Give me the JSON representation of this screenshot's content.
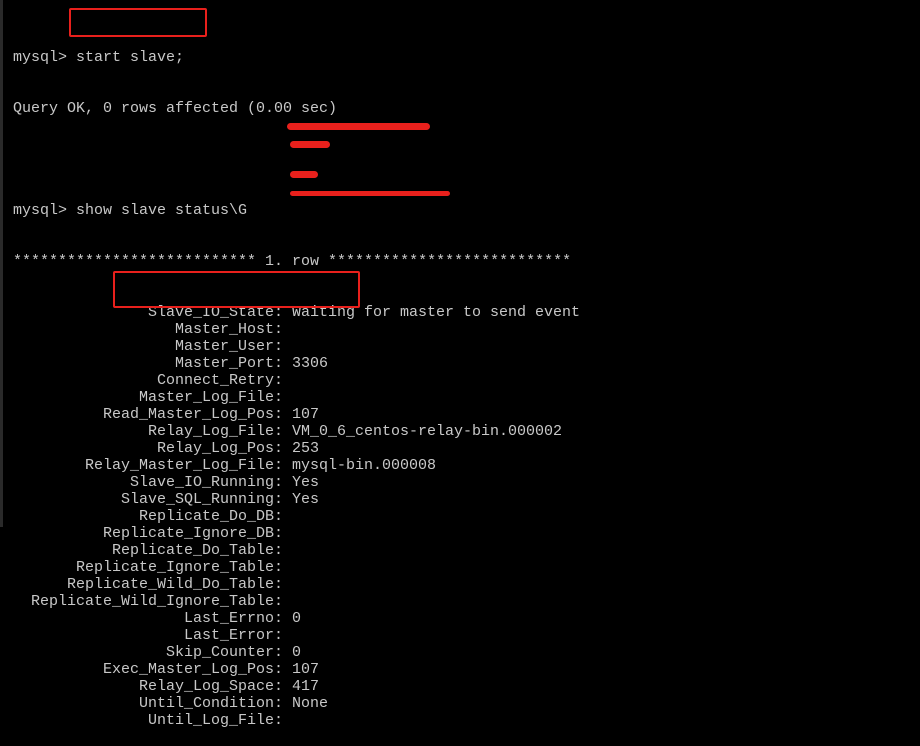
{
  "terminal": {
    "prompt": "mysql> ",
    "command1": "start slave;",
    "result1": "Query OK, 0 rows affected (0.00 sec)",
    "command2": "show slave status\\G",
    "row_header": "*************************** 1. row ***************************",
    "fields": [
      {
        "key": "Slave_IO_State",
        "value": "Waiting for master to send event"
      },
      {
        "key": "Master_Host",
        "value": "",
        "redacted": true
      },
      {
        "key": "Master_User",
        "value": "",
        "redacted": true
      },
      {
        "key": "Master_Port",
        "value": "3306"
      },
      {
        "key": "Connect_Retry",
        "value": "",
        "redacted": true
      },
      {
        "key": "Master_Log_File",
        "value": "",
        "redacted": true
      },
      {
        "key": "Read_Master_Log_Pos",
        "value": "107"
      },
      {
        "key": "Relay_Log_File",
        "value": "VM_0_6_centos-relay-bin.000002"
      },
      {
        "key": "Relay_Log_Pos",
        "value": "253"
      },
      {
        "key": "Relay_Master_Log_File",
        "value": "mysql-bin.000008"
      },
      {
        "key": "Slave_IO_Running",
        "value": "Yes"
      },
      {
        "key": "Slave_SQL_Running",
        "value": "Yes"
      },
      {
        "key": "Replicate_Do_DB",
        "value": ""
      },
      {
        "key": "Replicate_Ignore_DB",
        "value": ""
      },
      {
        "key": "Replicate_Do_Table",
        "value": ""
      },
      {
        "key": "Replicate_Ignore_Table",
        "value": ""
      },
      {
        "key": "Replicate_Wild_Do_Table",
        "value": ""
      },
      {
        "key": "Replicate_Wild_Ignore_Table",
        "value": ""
      },
      {
        "key": "Last_Errno",
        "value": "0"
      },
      {
        "key": "Last_Error",
        "value": ""
      },
      {
        "key": "Skip_Counter",
        "value": "0"
      },
      {
        "key": "Exec_Master_Log_Pos",
        "value": "107"
      },
      {
        "key": "Relay_Log_Space",
        "value": "417"
      },
      {
        "key": "Until_Condition",
        "value": "None"
      },
      {
        "key": "Until_Log_File",
        "value": ""
      }
    ]
  },
  "colors": {
    "text": "#c8c8c8",
    "background": "#000000",
    "highlight": "#e8201c"
  }
}
